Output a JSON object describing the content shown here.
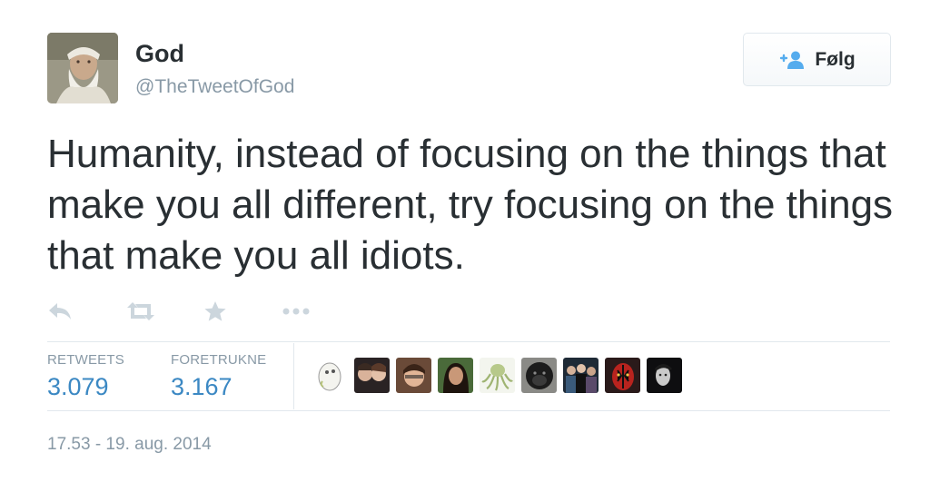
{
  "author": {
    "name": "God",
    "handle": "@TheTweetOfGod",
    "avatar_icon": "bearded-man-avatar"
  },
  "follow_button": {
    "label": "Følg",
    "icon": "add-person-icon",
    "icon_color": "#55acee"
  },
  "tweet": {
    "text": "Humanity, instead of focusing on the things that make you all different, try focusing on the things that make you all idiots."
  },
  "actions": [
    {
      "name": "reply",
      "icon": "reply-icon"
    },
    {
      "name": "retweet",
      "icon": "retweet-icon"
    },
    {
      "name": "favorite",
      "icon": "star-icon"
    },
    {
      "name": "more",
      "icon": "more-dots-icon"
    }
  ],
  "stats": {
    "retweets_label": "RETWEETS",
    "retweets_value": "3.079",
    "favorites_label": "FORETRUKNE",
    "favorites_value": "3.167"
  },
  "favorited_by_avatars": [
    "egg-avatar",
    "couple-avatar",
    "young-man-avatar",
    "woman-avatar",
    "octopus-avatar",
    "gorilla-avatar",
    "group-avatar",
    "darth-maul-avatar",
    "dark-portrait-avatar"
  ],
  "timestamp": "17.53 - 19. aug. 2014",
  "colors": {
    "text": "#292f33",
    "muted": "#8899a6",
    "link": "#3b88c3",
    "icon": "#ccd6dd",
    "border": "#e1e8ed"
  }
}
